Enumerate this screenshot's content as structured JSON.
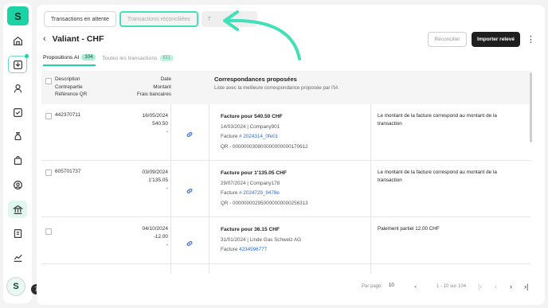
{
  "sidebar": {
    "logo": "S",
    "items": [
      {
        "name": "home-icon"
      },
      {
        "name": "inbox-icon"
      },
      {
        "name": "users-icon"
      },
      {
        "name": "checkbox-icon"
      },
      {
        "name": "money-bag-icon"
      },
      {
        "name": "shopping-bag-icon"
      },
      {
        "name": "contacts-icon"
      },
      {
        "name": "bank-icon"
      },
      {
        "name": "document-icon"
      },
      {
        "name": "chart-icon"
      }
    ],
    "avatar_initial": "S",
    "badge_count": "7"
  },
  "top_tabs": [
    {
      "label": "Transactions en attente"
    },
    {
      "label": "Transactions réconciliées"
    },
    {
      "label": "T"
    }
  ],
  "header": {
    "title": "Valiant - CHF",
    "reconcile_label": "Réconcilier",
    "import_label": "Importer relevé"
  },
  "sub_tabs": [
    {
      "label": "Propositions AI",
      "count": "104"
    },
    {
      "label": "Toutes les transactions",
      "count": "611"
    }
  ],
  "table": {
    "head_left": [
      "Description",
      "Contrepartie",
      "Référence QR"
    ],
    "head_right": [
      "Date",
      "Montant",
      "Frais bancaires"
    ],
    "match_title": "Correspondances proposées",
    "match_subtitle": "Liste avec la meilleure correspondance proposée par l'IA",
    "rows": [
      {
        "ref": "442370711",
        "date": "16/05/2024",
        "amount": "540.50",
        "fees": "-",
        "match_title": "Facture pour 540.50 CHF",
        "match_meta": "14/03/2024 | Company901",
        "invoice_prefix": "Facture ",
        "invoice_link": "# 2024314_0fe01",
        "qr": "QR - 000000030800000000000170612",
        "reason": "Le montant de la facture correspond au montant de la transaction"
      },
      {
        "ref": "605701737",
        "date": "03/09/2024",
        "amount": "1'135.05",
        "fees": "-",
        "match_title": "Facture pour 1'135.05 CHF",
        "match_meta": "29/07/2024 | Company178",
        "invoice_prefix": "Facture ",
        "invoice_link": "# 2024729_9478e",
        "qr": "QR - 000000002950000000000256313",
        "reason": "Le montant de la facture correspond au montant de la transaction"
      },
      {
        "ref": "",
        "date": "04/10/2024",
        "amount": "-12.00",
        "fees": "-",
        "match_title": "Facture pour 36.15 CHF",
        "match_meta": "31/01/2024 | Linde Gas Schweiz AG",
        "invoice_prefix": "Facture ",
        "invoice_link": "4234596777",
        "qr": "",
        "reason": "Paiement partiel 12.00 CHF"
      }
    ]
  },
  "pagination": {
    "per_page_label": "Par page:",
    "per_page_value": "10",
    "range": "1 - 10 sur 104"
  },
  "colors": {
    "accent": "#1bd3a5",
    "link": "#2d6bd6",
    "dark_button": "#1f1f1f"
  }
}
